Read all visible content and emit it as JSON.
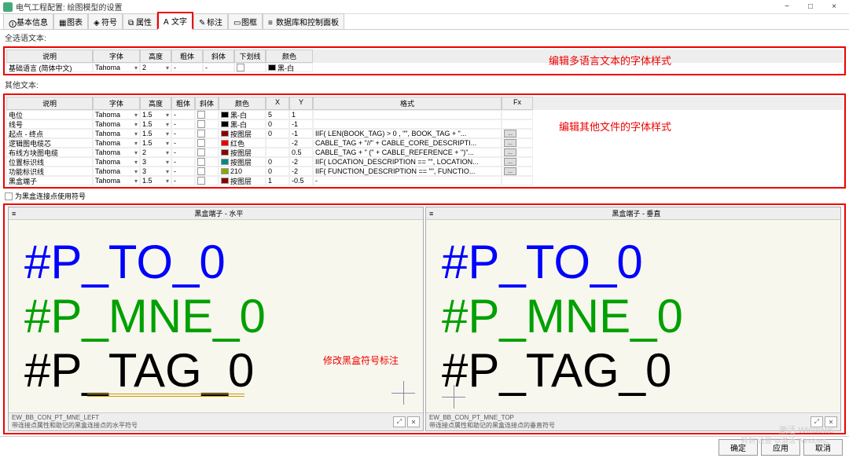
{
  "title": "电气工程配置: 绘图模型的设置",
  "tabs": [
    "基本信息",
    "图表",
    "符号",
    "属性",
    "文字",
    "标注",
    "图框",
    "数据库和控制面板"
  ],
  "active_tab": "文字",
  "section1_label": "全选语文本:",
  "section2_label": "其他文本:",
  "callout_top": "编辑多语言文本的字体样式",
  "callout_mid": "编辑其他文件的字体样式",
  "callout_preview": "修改黑盒符号标注",
  "head1": {
    "desc": "说明",
    "font": "字体",
    "h": "高度",
    "b": "粗体",
    "i": "斜体",
    "u": "下划线",
    "col": "颜色"
  },
  "row1": {
    "desc": "基础语言 (简体中文)",
    "font": "Tahoma",
    "h": "2",
    "b": "-",
    "i": "-",
    "u": "",
    "col": "黑-白"
  },
  "head2": {
    "desc": "说明",
    "font": "字体",
    "h": "高度",
    "b": "粗体",
    "i": "斜体",
    "col": "颜色",
    "x": "X",
    "y": "Y",
    "fmt": "格式",
    "fx": "Fx"
  },
  "rows2": [
    {
      "desc": "电位",
      "font": "Tahoma",
      "h": "1.5",
      "b": "-",
      "i": "",
      "col": "黑-白",
      "swatch": "#000",
      "x": "5",
      "y": "1",
      "fmt": "",
      "fx": ""
    },
    {
      "desc": "线号",
      "font": "Tahoma",
      "h": "1.5",
      "b": "-",
      "i": "",
      "col": "黑-白",
      "swatch": "#000",
      "x": "0",
      "y": "-1",
      "fmt": "",
      "fx": ""
    },
    {
      "desc": "起点 - 终点",
      "font": "Tahoma",
      "h": "1.5",
      "b": "-",
      "i": "",
      "col": "按图层",
      "swatch": "#800",
      "x": "0",
      "y": "-1",
      "fmt": "IIF( LEN(BOOK_TAG) > 0 , \"\", BOOK_TAG + \"...",
      "fx": "..."
    },
    {
      "desc": "逻辑图电缆芯",
      "font": "Tahoma",
      "h": "1.5",
      "b": "-",
      "i": "",
      "col": "红色",
      "swatch": "#e00",
      "x": "",
      "y": "-2",
      "fmt": "CABLE_TAG + \"//\" + CABLE_CORE_DESCRIPTI...",
      "fx": "..."
    },
    {
      "desc": "布线方块图电缆",
      "font": "Tahoma",
      "h": "2",
      "b": "-",
      "i": "",
      "col": "按图层",
      "swatch": "#800",
      "x": "",
      "y": "0.5",
      "fmt": "CABLE_TAG + \" (\" + CABLE_REFERENCE + \")\"...",
      "fx": "..."
    },
    {
      "desc": "位置标识线",
      "font": "Tahoma",
      "h": "3",
      "b": "-",
      "i": "",
      "col": "按图层",
      "swatch": "#088",
      "x": "0",
      "y": "-2",
      "fmt": "IIF( LOCATION_DESCRIPTION == \"\", LOCATION...",
      "fx": "..."
    },
    {
      "desc": "功能标识线",
      "font": "Tahoma",
      "h": "3",
      "b": "-",
      "i": "",
      "col": "210",
      "swatch": "#8a0",
      "x": "0",
      "y": "-2",
      "fmt": "IIF( FUNCTION_DESCRIPTION == \"\", FUNCTIO...",
      "fx": "..."
    },
    {
      "desc": "黑盒端子",
      "font": "Tahoma",
      "h": "1.5",
      "b": "-",
      "i": "",
      "col": "按图层",
      "swatch": "#800",
      "x": "1",
      "y": "-0.5",
      "fmt": "-",
      "fx": ""
    }
  ],
  "chk_label": "为黑盒连接点使用符号",
  "pane1": {
    "title": "黑盒端子 - 水平",
    "foot_id": "EW_BB_CON_PT_MNE_LEFT",
    "foot_desc": "带连接点属性和助记的黑盒连接点的水平符号"
  },
  "pane2": {
    "title": "黑盒端子 - 垂直",
    "foot_id": "EW_BB_CON_PT_MNE_TOP",
    "foot_desc": "带连接点属性和助记的黑盒连接点的垂直符号"
  },
  "preview": {
    "line1": "#P_TO_0",
    "line2": "#P_MNE_0",
    "line3": "#P_TAG_0"
  },
  "watermark1": "激活 Windows",
  "watermark2": "转到\"设置\"以激活 Windows。",
  "buttons": {
    "ok": "确定",
    "apply": "应用",
    "cancel": "取消"
  }
}
